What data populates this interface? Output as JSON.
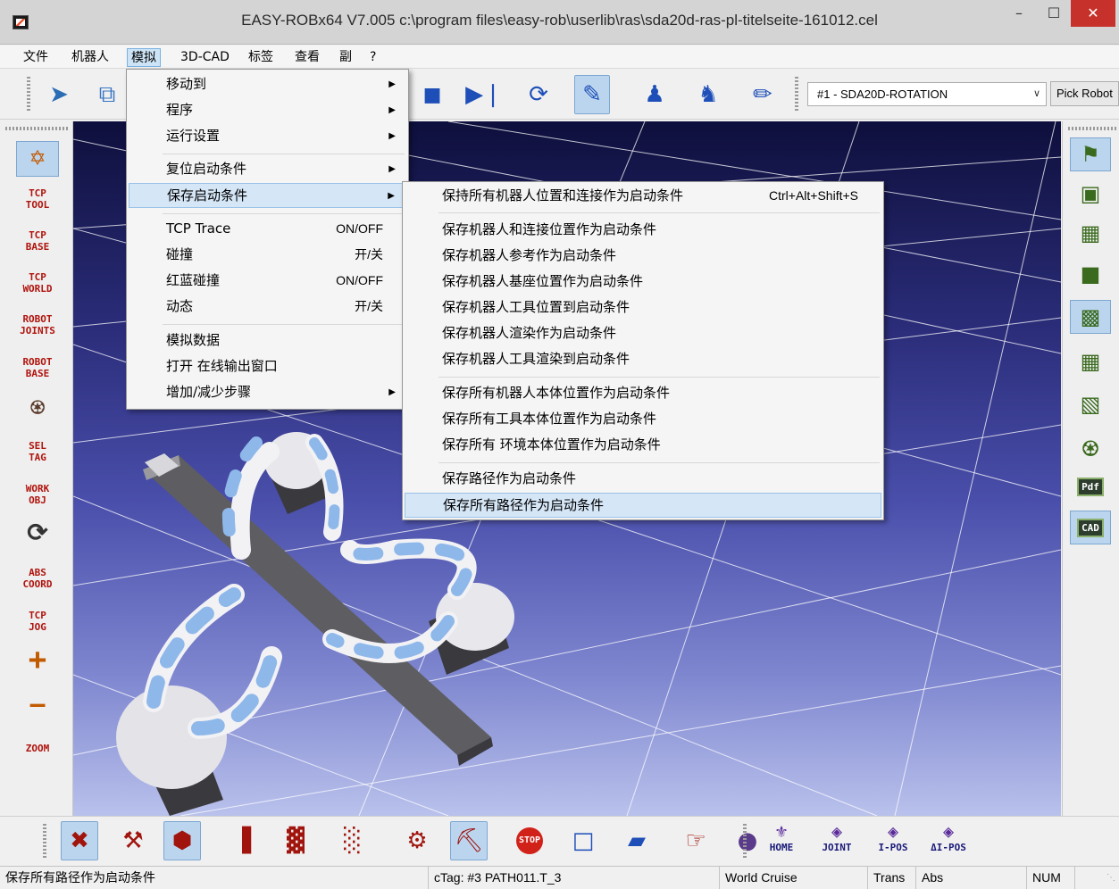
{
  "window": {
    "title": "EASY-ROBx64 V7.005 c:\\program files\\easy-rob\\userlib\\ras\\sda20d-ras-pl-titelseite-161012.cel",
    "minimize": "–",
    "maximize": "☐",
    "close": "✕"
  },
  "menubar": {
    "items": [
      "文件",
      "机器人",
      "模拟",
      "3D-CAD",
      "标签",
      "查看",
      "副",
      "?"
    ],
    "active": "模拟"
  },
  "toolbar": {
    "robot_select": "#1 - SDA20D-ROTATION",
    "pick_robot": "Pick Robot",
    "icons": [
      "sync-icon",
      "cube-icon",
      "stop-icon",
      "step-forward-icon",
      "loop-icon",
      "clapper-icon",
      "walker-icon",
      "runner-icon",
      "pen-icon"
    ]
  },
  "left_panel": {
    "buttons": [
      "TCP\nTOOL",
      "TCP\nBASE",
      "TCP\nWORLD",
      "ROBOT\nJOINTS",
      "ROBOT\nBASE",
      "SEL\nTAG",
      "WORK\nOBJ",
      "ABS\nCOORD",
      "TCP\nJOG",
      "ZOOM"
    ],
    "plus": "+",
    "minus": "—"
  },
  "right_panel": {
    "pdf": "Pdf",
    "cad": "CAD"
  },
  "bottom_bar": {
    "nav": [
      "HOME",
      "JOINT",
      "I-POS",
      "ΔI-POS"
    ],
    "stop": "STOP"
  },
  "sim_menu": {
    "items": [
      {
        "label": "移动到",
        "shortcut": "",
        "submenu": true
      },
      {
        "label": "程序",
        "shortcut": "",
        "submenu": true
      },
      {
        "label": "运行设置",
        "shortcut": "",
        "submenu": true
      },
      {
        "label": "复位启动条件",
        "shortcut": "",
        "submenu": true
      },
      {
        "label": "保存启动条件",
        "shortcut": "",
        "submenu": true
      },
      {
        "label": "TCP Trace",
        "shortcut": "ON/OFF",
        "submenu": false
      },
      {
        "label": "碰撞",
        "shortcut": "开/关",
        "submenu": false
      },
      {
        "label": "红蓝碰撞",
        "shortcut": "ON/OFF",
        "submenu": false
      },
      {
        "label": "动态",
        "shortcut": "开/关",
        "submenu": false
      },
      {
        "label": "模拟数据",
        "shortcut": "",
        "submenu": false
      },
      {
        "label": "打开 在线输出窗口",
        "shortcut": "",
        "submenu": false
      },
      {
        "label": "增加/减少步骤",
        "shortcut": "",
        "submenu": true
      }
    ],
    "highlighted": "保存启动条件"
  },
  "save_submenu": {
    "items": [
      {
        "label": "保持所有机器人位置和连接作为启动条件",
        "shortcut": "Ctrl+Alt+Shift+S"
      },
      {
        "label": "保存机器人和连接位置作为启动条件",
        "shortcut": ""
      },
      {
        "label": "保存机器人参考作为启动条件",
        "shortcut": ""
      },
      {
        "label": "保存机器人基座位置作为启动条件",
        "shortcut": ""
      },
      {
        "label": "保存机器人工具位置到启动条件",
        "shortcut": ""
      },
      {
        "label": "保存机器人渲染作为启动条件",
        "shortcut": ""
      },
      {
        "label": "保存机器人工具渲染到启动条件",
        "shortcut": ""
      },
      {
        "label": "保存所有机器人本体位置作为启动条件",
        "shortcut": ""
      },
      {
        "label": "保存所有工具本体位置作为启动条件",
        "shortcut": ""
      },
      {
        "label": "保存所有 环境本体位置作为启动条件",
        "shortcut": ""
      },
      {
        "label": "保存路径作为启动条件",
        "shortcut": ""
      },
      {
        "label": "保存所有路径作为启动条件",
        "shortcut": ""
      }
    ],
    "highlighted": "保存所有路径作为启动条件"
  },
  "status": {
    "message": "保存所有路径作为启动条件",
    "ctag": "cTag: #3 PATH011.T_3",
    "mode": "World Cruise",
    "trans": "Trans",
    "abs": "Abs",
    "num": "NUM"
  },
  "colors": {
    "accent": "#cde4f7",
    "close_red": "#c7312b",
    "label_red": "#b0140d",
    "robot_blue": "#8fb8ea"
  }
}
